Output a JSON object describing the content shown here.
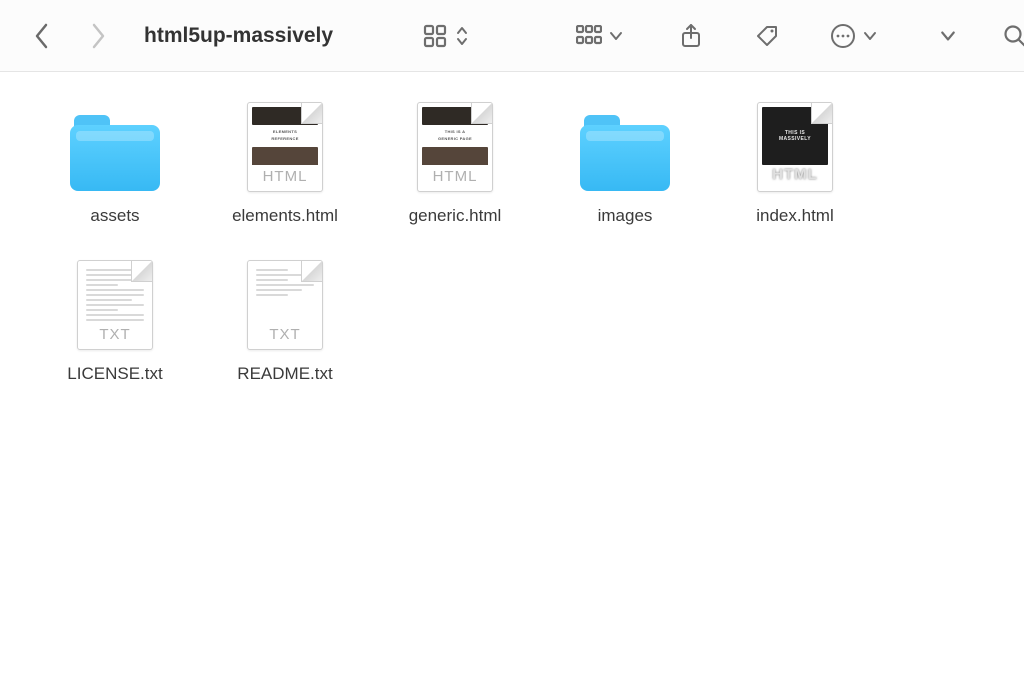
{
  "title": "html5up-massively",
  "preview": {
    "elements": {
      "title": "ELEMENTS",
      "sub": "REFERENCE"
    },
    "generic": {
      "title": "THIS IS A",
      "sub": "GENERIC PAGE"
    },
    "index": {
      "line1": "THIS IS",
      "line2": "MASSIVELY"
    }
  },
  "ext": {
    "html": "HTML",
    "txt": "TXT"
  },
  "items": [
    {
      "name": "assets",
      "kind": "folder"
    },
    {
      "name": "elements.html",
      "kind": "html",
      "variant": "light",
      "preview": "elements"
    },
    {
      "name": "generic.html",
      "kind": "html",
      "variant": "light",
      "preview": "generic"
    },
    {
      "name": "images",
      "kind": "folder"
    },
    {
      "name": "index.html",
      "kind": "html",
      "variant": "dark",
      "preview": "index"
    },
    {
      "name": "LICENSE.txt",
      "kind": "txt"
    },
    {
      "name": "README.txt",
      "kind": "txt"
    }
  ]
}
